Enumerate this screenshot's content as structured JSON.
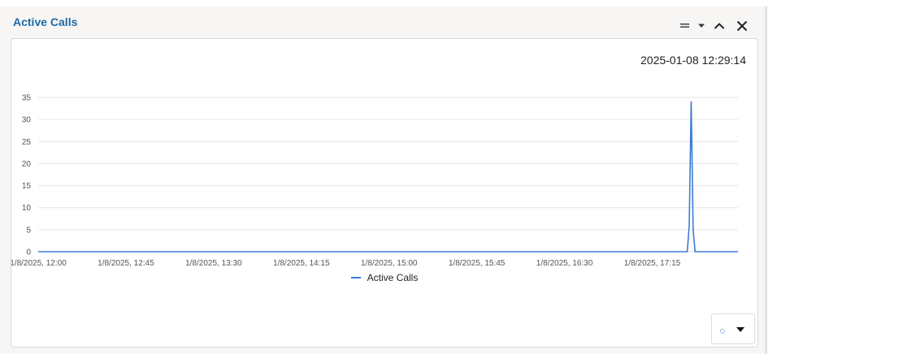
{
  "widget": {
    "title": "Active Calls",
    "timestamp": "2025-01-08 12:29:14"
  },
  "header_icons": {
    "menu": "hamburger-dropdown-icon",
    "collapse": "chevron-up-icon",
    "close": "close-icon"
  },
  "settings": {
    "icon": "gear-icon",
    "dropdown_icon": "caret-down-icon"
  },
  "colors": {
    "title": "#1f6aa5",
    "series": "#3a7bd5"
  },
  "chart_data": {
    "type": "line",
    "title": "",
    "xlabel": "",
    "ylabel": "",
    "ylim": [
      0,
      35
    ],
    "yticks": [
      0,
      5,
      10,
      15,
      20,
      25,
      30,
      35
    ],
    "xlim": [
      "1/8/2025, 12:00",
      "1/8/2025, 17:59"
    ],
    "x_ticks": [
      "1/8/2025, 12:00",
      "1/8/2025, 12:45",
      "1/8/2025, 13:30",
      "1/8/2025, 14:15",
      "1/8/2025, 15:00",
      "1/8/2025, 15:45",
      "1/8/2025, 16:30",
      "1/8/2025, 17:15"
    ],
    "grid": true,
    "legend_position": "bottom",
    "series": [
      {
        "name": "Active Calls",
        "x": [
          "1/8/2025, 12:00",
          "1/8/2025, 17:33",
          "1/8/2025, 17:34",
          "1/8/2025, 17:35",
          "1/8/2025, 17:36",
          "1/8/2025, 17:37",
          "1/8/2025, 17:59"
        ],
        "values": [
          0,
          0,
          6,
          34,
          5,
          0,
          0
        ]
      }
    ]
  }
}
